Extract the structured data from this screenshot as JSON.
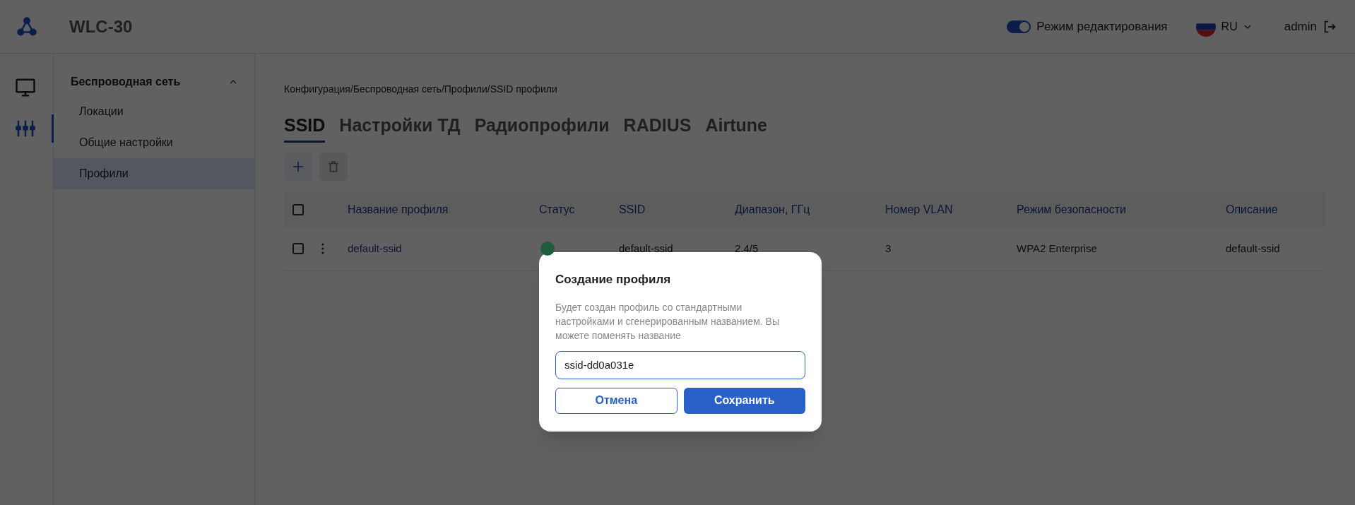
{
  "header": {
    "title": "WLC-30",
    "edit_mode": {
      "label": "Режим редактирования",
      "on": true
    },
    "language": "RU",
    "user": "admin"
  },
  "rail": [
    {
      "kind": "monitor",
      "selected": false
    },
    {
      "kind": "config",
      "selected": true
    }
  ],
  "sidebar": {
    "section": {
      "label": "Беспроводная сеть",
      "expanded": true
    },
    "items": [
      {
        "label": "Локации",
        "selected": false
      },
      {
        "label": "Общие настройки",
        "selected": false
      },
      {
        "label": "Профили",
        "selected": true
      }
    ]
  },
  "breadcrumb": "Конфигурация/Беспроводная сеть/Профили/SSID профили",
  "tabs": [
    {
      "label": "SSID",
      "selected": true
    },
    {
      "label": "Настройки ТД",
      "selected": false
    },
    {
      "label": "Радиопрофили",
      "selected": false
    },
    {
      "label": "RADIUS",
      "selected": false
    },
    {
      "label": "Airtune",
      "selected": false
    }
  ],
  "toolbar": {
    "add_disabled": false,
    "delete_disabled": true
  },
  "table": {
    "select_all_checked": false,
    "columns": [
      "Название профиля",
      "Статус",
      "SSID",
      "Диапазон, ГГц",
      "Номер VLAN",
      "Режим безопасности",
      "Описание"
    ],
    "rows": [
      {
        "checked": false,
        "name": "default-ssid",
        "color": "#1d5c3e",
        "ssid": "default-ssid",
        "range": "2.4/5",
        "vlan": "3",
        "security": "WPA2 Enterprise",
        "description": "default-ssid"
      }
    ]
  },
  "dialog": {
    "title": "Создание профиля",
    "text": "Будет создан профиль со стандартными настройками и сгенерированным названием. Вы можете поменять название",
    "value": "ssid-dd0a031e",
    "cancel": "Отмена",
    "save": "Сохранить"
  }
}
